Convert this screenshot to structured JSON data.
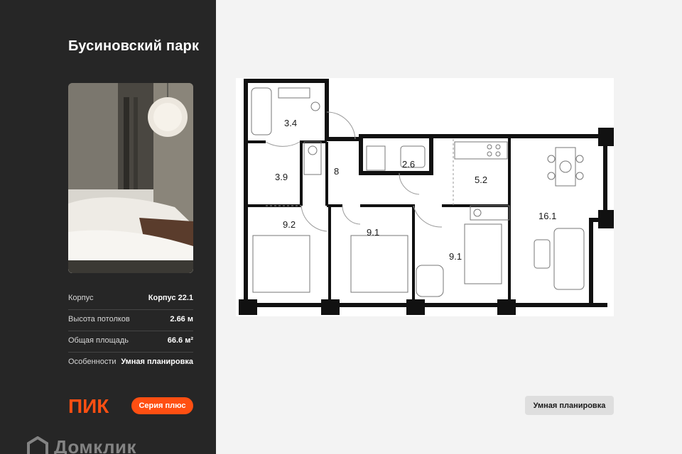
{
  "sidebar": {
    "project_title": "Бусиновский парк",
    "specs": [
      {
        "label": "Корпус",
        "value": "Корпус 22.1"
      },
      {
        "label": "Высота потолков",
        "value": "2.66 м"
      },
      {
        "label": "Общая площадь",
        "value": "66.6 м²"
      },
      {
        "label": "Особенности",
        "value": "Умная планировка"
      }
    ],
    "brand_logo": "ПИК",
    "series_badge": "Серия плюс",
    "partner_logo": "Домклик"
  },
  "floorplan": {
    "rooms": [
      {
        "id": "bathroom",
        "area": "3.4"
      },
      {
        "id": "hall-small",
        "area": "3.9"
      },
      {
        "id": "hallway",
        "area": "8"
      },
      {
        "id": "wc",
        "area": "2.6"
      },
      {
        "id": "kitchen",
        "area": "5.2"
      },
      {
        "id": "living",
        "area": "16.1"
      },
      {
        "id": "bedroom-1",
        "area": "9.2"
      },
      {
        "id": "bedroom-2",
        "area": "9.1"
      },
      {
        "id": "bedroom-3",
        "area": "9.1"
      }
    ]
  },
  "badge": {
    "smart_layout": "Умная планировка"
  },
  "colors": {
    "sidebar_bg": "#262626",
    "accent": "#ff4f12",
    "page_bg": "#f3f3f3",
    "badge_bg": "#dedede"
  }
}
